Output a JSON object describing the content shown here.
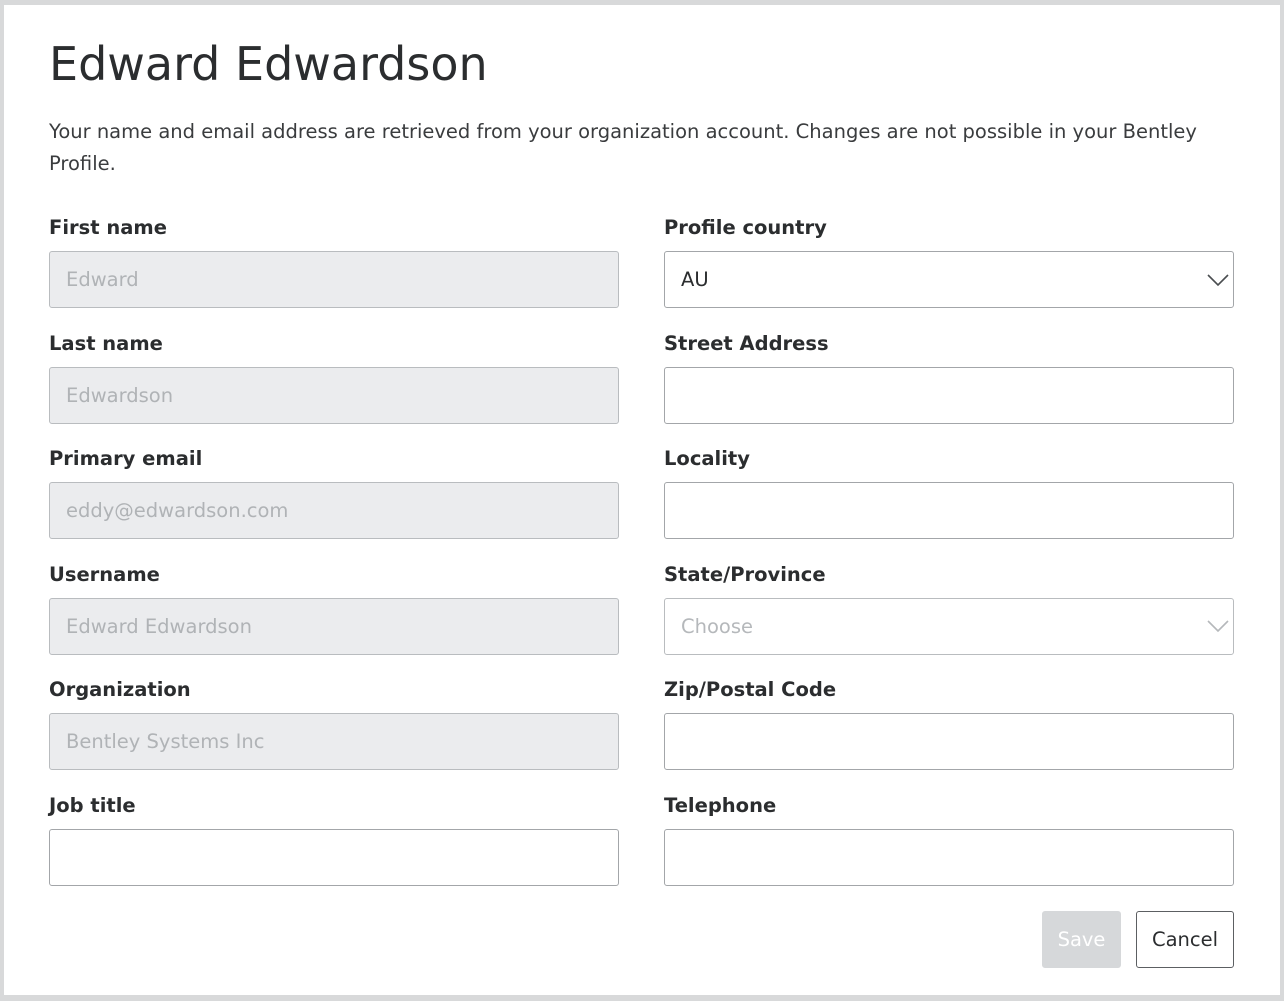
{
  "profile": {
    "name": "Edward Edwardson",
    "intro": "Your name and email address are retrieved from your organization account. Changes are not possible in your Bentley Profile."
  },
  "left_fields": [
    {
      "label": "First name",
      "value": "Edward",
      "disabled": true
    },
    {
      "label": "Last name",
      "value": "Edwardson",
      "disabled": true
    },
    {
      "label": "Primary email",
      "value": "eddy@edwardson.com",
      "disabled": true
    },
    {
      "label": "Username",
      "value": "Edward Edwardson",
      "disabled": true
    },
    {
      "label": "Organization",
      "value": "Bentley Systems Inc",
      "disabled": true
    },
    {
      "label": "Job title",
      "value": "",
      "disabled": false
    }
  ],
  "right_fields": [
    {
      "label": "Profile country",
      "value": "AU",
      "type": "select"
    },
    {
      "label": "Street Address",
      "value": "",
      "type": "text"
    },
    {
      "label": "Locality",
      "value": "",
      "type": "text"
    },
    {
      "label": "State/Province",
      "placeholder": "Choose",
      "type": "select"
    },
    {
      "label": "Zip/Postal Code",
      "value": "",
      "type": "text"
    },
    {
      "label": "Telephone",
      "value": "",
      "type": "text"
    }
  ],
  "actions": {
    "save_label": "Save",
    "cancel_label": "Cancel"
  },
  "icons": {
    "select_chevron": "chevron-down-icon"
  }
}
